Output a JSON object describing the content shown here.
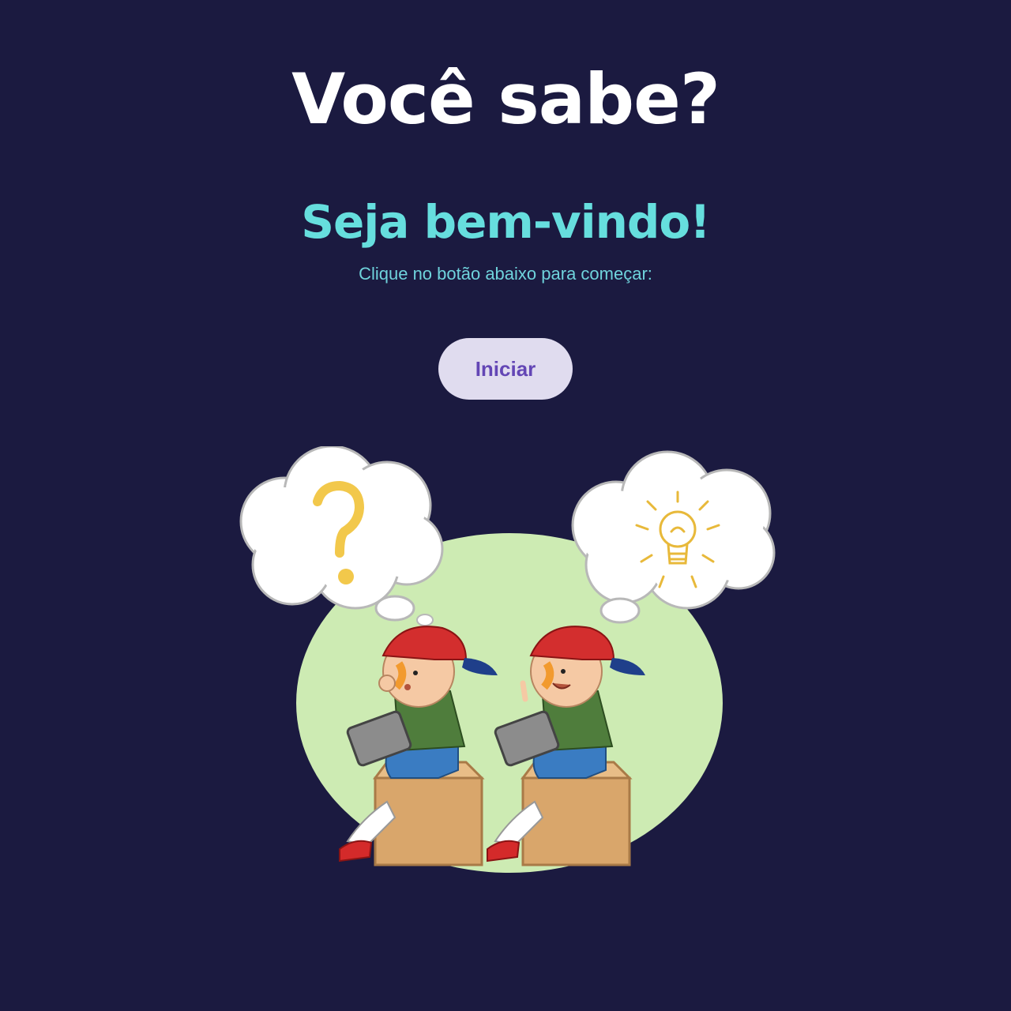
{
  "header": {
    "title": "Você sabe?",
    "welcome": "Seja bem-vindo!",
    "instruction": "Clique no botão abaixo para começar:"
  },
  "actions": {
    "start_label": "Iniciar"
  },
  "colors": {
    "background": "#1b1a40",
    "title": "#ffffff",
    "accent": "#66dede",
    "button_bg": "#e0dcef",
    "button_text": "#6346b5"
  },
  "illustration": {
    "icons": [
      "question-mark-icon",
      "light-bulb-icon"
    ]
  }
}
